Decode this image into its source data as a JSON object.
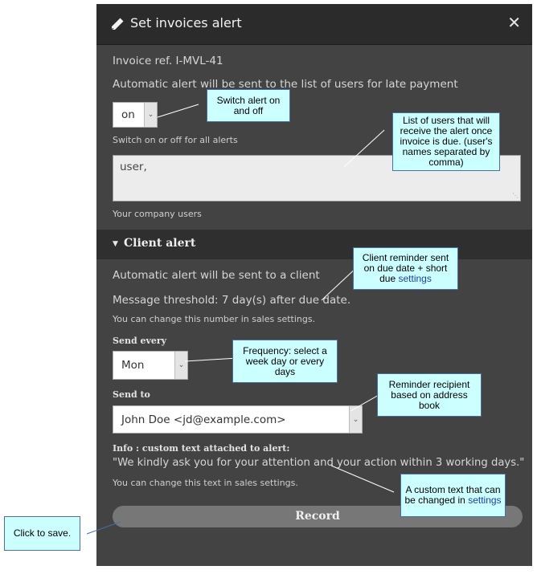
{
  "modal": {
    "title": "Set invoices alert",
    "title_icon": "pencil-icon",
    "close_icon": "close-icon",
    "close_glyph": "✕",
    "invoice_ref": "Invoice ref. I-MVL-41",
    "users_alert_text": "Automatic alert will be sent to the list of users for late payment",
    "switch": {
      "value": "on",
      "hint": "Switch on or off for all alerts"
    },
    "users_field": {
      "value": "user,",
      "hint": "Your company users"
    },
    "client_section": {
      "label": "Client alert",
      "expanded_icon": "triangle-down-icon",
      "description": "Automatic alert will be sent to a client",
      "threshold": "Message threshold: 7 day(s) after due date.",
      "threshold_hint": "You can change this number in sales settings.",
      "send_every": {
        "label": "Send every",
        "value": "Mon"
      },
      "send_to": {
        "label": "Send to",
        "value": "John Doe <jd@example.com>"
      },
      "info_label": "Info : custom text attached to alert:",
      "custom_text": "\"We kindly ask you for your attention and your action within 3 working days.\"",
      "custom_text_hint": "You can change this text in sales settings."
    },
    "record_label": "Record"
  },
  "callouts": {
    "switch": "Switch alert on and off",
    "users": "List of users that will receive the alert once invoice is due. (user's names separated by comma)",
    "client_reminder": {
      "text": "Client reminder sent on due date + short due",
      "link": "settings"
    },
    "frequency": "Frequency: select a week day or every days",
    "recipient": "Reminder recipient based on address book",
    "custom_text": {
      "text": "A custom text that can be changed in",
      "link": "settings"
    },
    "save": "Click to save."
  },
  "colors": {
    "modal_bg": "#434343",
    "header_bg": "#2b2b2b",
    "callout_bg": "#ccffff",
    "link": "#1a3ea8"
  }
}
